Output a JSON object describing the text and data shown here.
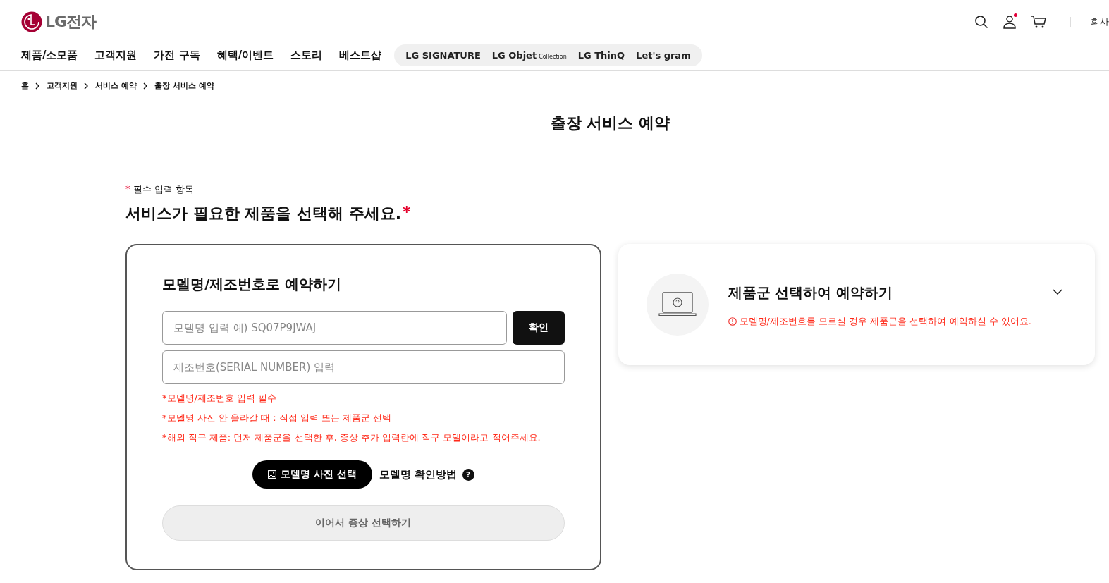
{
  "header": {
    "logo": "LG전자",
    "nav": [
      "제품/소모품",
      "고객지원",
      "가전 구독",
      "혜택/이벤트",
      "스토리",
      "베스트샵"
    ],
    "brands": [
      {
        "text": "LG SIGNATURE"
      },
      {
        "text": "LG Objet",
        "sub": "Collection"
      },
      {
        "text": "LG ThinQ"
      },
      {
        "text": "Let's gram"
      }
    ],
    "user_notification": true,
    "company_link": "회사"
  },
  "breadcrumb": [
    "홈",
    "고객지원",
    "서비스 예약",
    "출장 서비스 예약"
  ],
  "page_title": "출장 서비스 예약",
  "required_note": {
    "mark": "*",
    "text": "필수 입력 항목"
  },
  "section_heading": {
    "text": "서비스가 필요한 제품을 선택해 주세요.",
    "mark": "*"
  },
  "booking_options": [
    {
      "kind": "model",
      "selected": true,
      "title": "모델명/제조번호로 예약하기",
      "model_placeholder": "모델명 입력 예) SQ07P9JWAJ",
      "confirm_button": "확인",
      "serial_placeholder": "제조번호(SERIAL NUMBER) 입력",
      "notes": [
        "*모델명/제조번호 입력 필수",
        "*모델명 사진 안 올라갈 때 : 직접 입력 또는 제품군 선택",
        "*해외 직구 제품: 먼저 제품군을 선택한 후, 증상 추가 입력란에 직구 모델이라고 적어주세요."
      ],
      "photo_button": "모델명 사진 선택",
      "help_link": "모델명 확인방법",
      "help_icon": "?",
      "next_button": {
        "label": "이어서 증상 선택하기",
        "disabled": true
      }
    },
    {
      "kind": "category",
      "selected": false,
      "title": "제품군 선택하여 예약하기",
      "notice": "모델명/제조번호를 모르실 경우 제품군을 선택하여 예약하실 수 있어요.",
      "expanded": false
    }
  ]
}
